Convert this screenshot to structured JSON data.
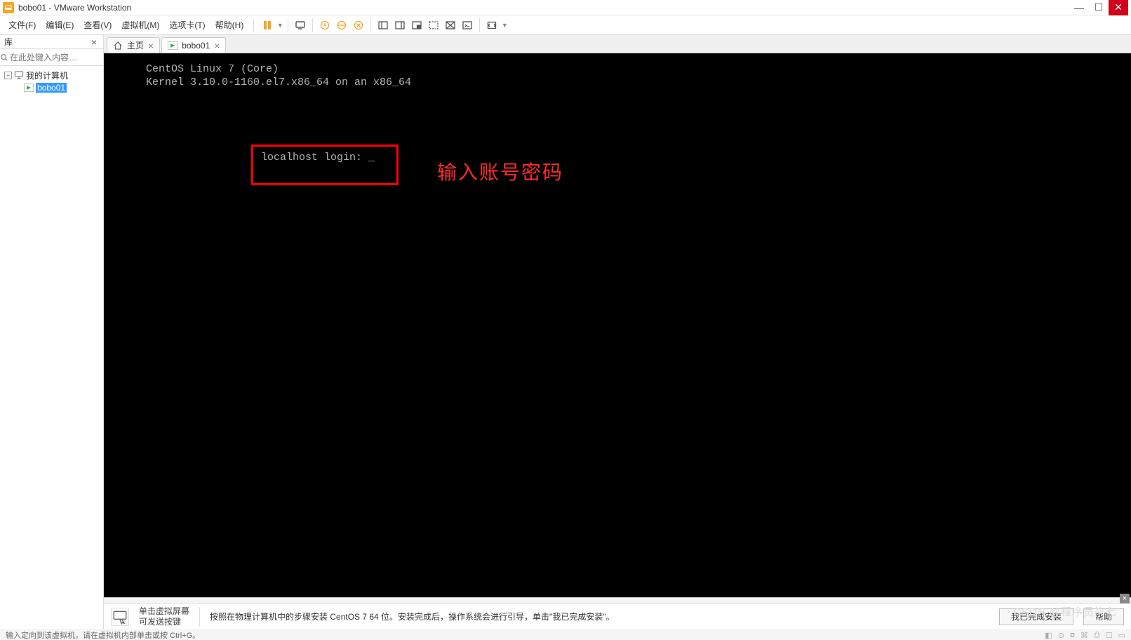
{
  "title": "bobo01 - VMware Workstation",
  "menu": {
    "file": "文件(F)",
    "edit": "编辑(E)",
    "view": "查看(V)",
    "vm": "虚拟机(M)",
    "tabs": "选项卡(T)",
    "help": "帮助(H)"
  },
  "sidebar": {
    "header": "库",
    "search_placeholder": "在此处键入内容…",
    "tree": {
      "root": "我的计算机",
      "vm": "bobo01"
    }
  },
  "tabs": {
    "home": "主页",
    "vm": "bobo01"
  },
  "terminal": {
    "line1": "CentOS Linux 7 (Core)",
    "line2": "Kernel 3.10.0-1160.el7.x86_64 on an x86_64",
    "login": "localhost login: _"
  },
  "annotation": "输入账号密码",
  "bottom": {
    "hint": "单击虚拟屏幕\n可发送按键",
    "instruction": "按照在物理计算机中的步骤安装 CentOS 7 64 位。安装完成后，操作系统会进行引导，单击\"我已完成安装\"。",
    "btn_done": "我已完成安装",
    "btn_help": "帮助"
  },
  "status": {
    "left": "输入定向到该虚拟机，请在虚拟机内部单击或按 Ctrl+G。"
  },
  "watermark": "CSDN @程序员柒七"
}
